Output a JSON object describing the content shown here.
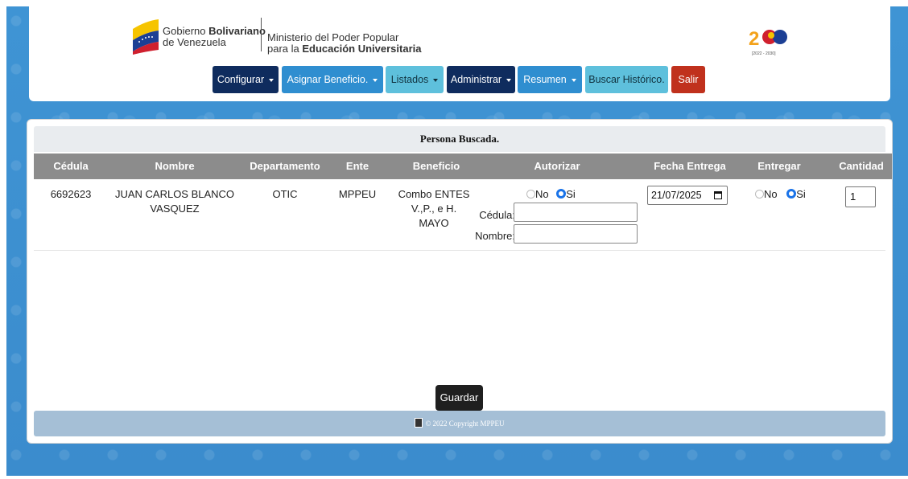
{
  "header": {
    "gov_line1_prefix": "Gobierno ",
    "gov_line1_bold": "Bolivariano",
    "gov_line2": "de Venezuela",
    "ministry_line1": "Ministerio del Poder Popular",
    "ministry_line2_prefix": "para la ",
    "ministry_line2_bold": "Educación Universitaria",
    "emblem_text": "[2022 - 2030]"
  },
  "nav": [
    {
      "label": "Configurar",
      "dropdown": true
    },
    {
      "label": "Asignar Beneficio.",
      "dropdown": true
    },
    {
      "label": "Listados",
      "dropdown": true
    },
    {
      "label": "Administrar",
      "dropdown": true
    },
    {
      "label": "Resumen",
      "dropdown": true
    },
    {
      "label": "Buscar Histórico.",
      "dropdown": false
    },
    {
      "label": "Salir",
      "dropdown": false
    }
  ],
  "colors": {
    "navy": "#0f2c5e",
    "blue": "#2f8ed0",
    "cyan": "#5ec0dc",
    "red": "#c0311d",
    "table_header": "#8c8c8c",
    "footer": "#a5bfd6",
    "background": "#3b8fcf"
  },
  "table": {
    "title": "Persona Buscada.",
    "headers": [
      "Cédula",
      "Nombre",
      "Departamento",
      "Ente",
      "Beneficio",
      "Autorizar",
      "Fecha Entrega",
      "Entregar",
      "Cantidad"
    ],
    "row": {
      "cedula": "6692623",
      "nombre_line1": "JUAN CARLOS BLANCO",
      "nombre_line2": "VASQUEZ",
      "departamento": "OTIC",
      "ente": "MPPEU",
      "beneficio_line1": "Combo ENTES",
      "beneficio_line2": "V.,P., e H.",
      "beneficio_line3": "MAYO",
      "autorizar": {
        "no_label": "No",
        "si_label": "Si",
        "selected": "Si"
      },
      "cedula_label": "Cédula:",
      "cedula_value": "",
      "nombre_label": "Nombre:",
      "nombre_value": "",
      "fecha_entrega": "21/07/2025",
      "entregar": {
        "no_label": "No",
        "si_label": "Si",
        "selected": "Si"
      },
      "cantidad": "1"
    }
  },
  "actions": {
    "save_label": "Guardar"
  },
  "footer": {
    "text": "© 2022 Copyright MPPEU"
  }
}
